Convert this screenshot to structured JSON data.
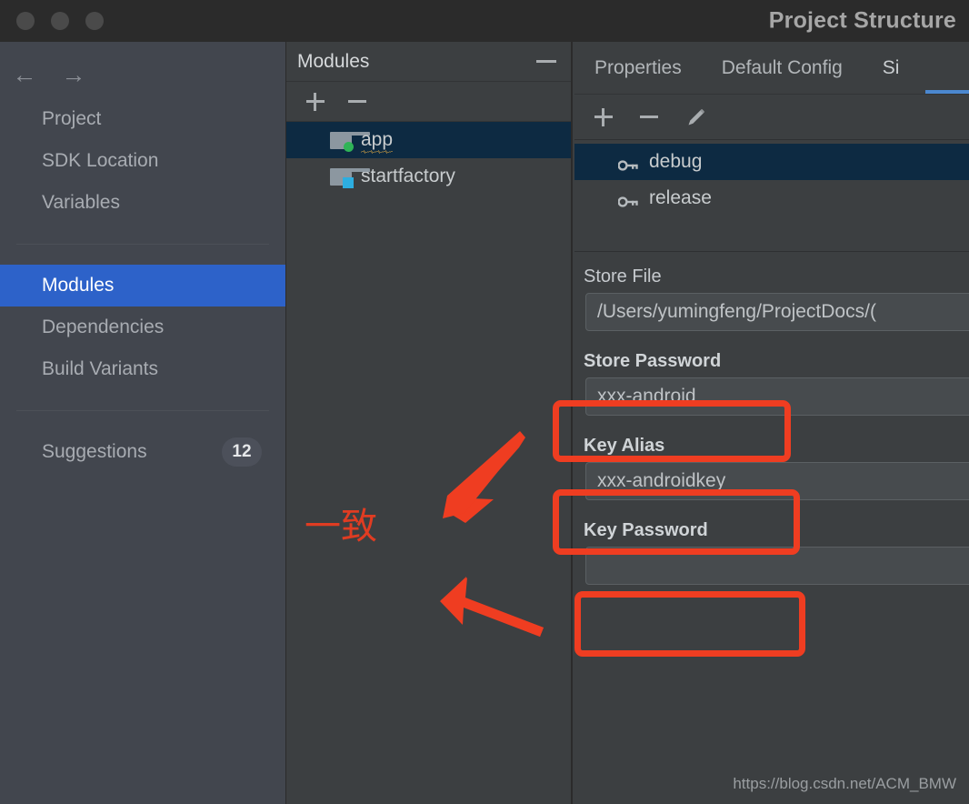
{
  "window": {
    "title": "Project Structure",
    "traffic_lights": [
      "close-button",
      "minimize-button",
      "zoom-button"
    ]
  },
  "sidebar": {
    "back_icon": "←",
    "forward_icon": "→",
    "items": [
      {
        "label": "Project",
        "selected": false
      },
      {
        "label": "SDK Location",
        "selected": false
      },
      {
        "label": "Variables",
        "selected": false
      },
      {
        "label": "Modules",
        "selected": true
      },
      {
        "label": "Dependencies",
        "selected": false
      },
      {
        "label": "Build Variants",
        "selected": false
      }
    ],
    "suggestions": {
      "label": "Suggestions",
      "count": "12"
    }
  },
  "modules_panel": {
    "title": "Modules",
    "minimize_label": "minimize",
    "toolbar": {
      "add": "+",
      "remove": "−"
    },
    "items": [
      {
        "label": "app",
        "selected": true,
        "badge_color": "#2fb457",
        "badge_shape": "circle",
        "has_warning_underline": true
      },
      {
        "label": "startfactory",
        "selected": false,
        "badge_color": "#2daee0",
        "badge_shape": "square",
        "has_warning_underline": false
      }
    ]
  },
  "right_panel": {
    "tabs": [
      {
        "label": "Properties",
        "active": false
      },
      {
        "label": "Default Config",
        "active": false
      },
      {
        "label": "Si",
        "active": true
      }
    ],
    "toolbar": {
      "add": "+",
      "remove": "−",
      "edit": "edit-pencil"
    },
    "signing_configs": [
      {
        "label": "debug",
        "selected": true
      },
      {
        "label": "release",
        "selected": false
      }
    ],
    "fields": [
      {
        "label": "Store File",
        "value": "/Users/yumingfeng/ProjectDocs/(",
        "bold": false,
        "highlighted": false
      },
      {
        "label": "Store Password",
        "value": "xxx-android",
        "bold": true,
        "highlighted": true
      },
      {
        "label": "Key Alias",
        "value": "xxx-androidkey",
        "bold": true,
        "highlighted": true
      },
      {
        "label": "Key Password",
        "value": "",
        "bold": true,
        "highlighted": true
      }
    ]
  },
  "annotations": {
    "note_text": "一致",
    "color": "#ef3d21",
    "arrow_count": 2
  },
  "watermark": "https://blog.csdn.net/ACM_BMW"
}
